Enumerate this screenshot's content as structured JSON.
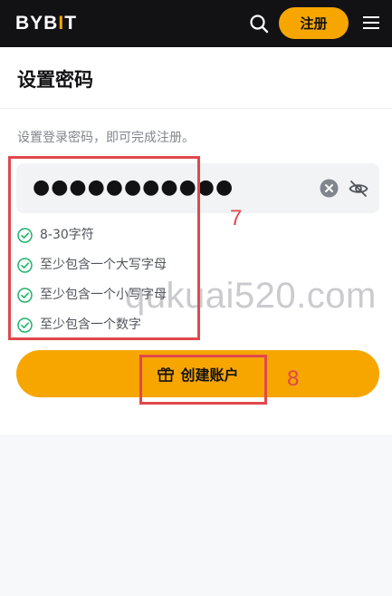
{
  "header": {
    "logo": {
      "prefix": "BYB",
      "highlight": "I",
      "suffix": "T"
    },
    "register_label": "注册",
    "icons": {
      "search": "search-icon",
      "menu": "menu-icon"
    }
  },
  "form": {
    "title": "设置密码",
    "subtitle": "设置登录密码，即可完成注册。",
    "password_value": "●●●●●●●●●●●",
    "icons": {
      "clear": "clear-circle-icon",
      "visibility": "eye-off-icon"
    },
    "rules": [
      {
        "text": "8-30字符",
        "status": "passed"
      },
      {
        "text": "至少包含一个大写字母",
        "status": "passed"
      },
      {
        "text": "至少包含一个小写字母",
        "status": "passed"
      },
      {
        "text": "至少包含一个数字",
        "status": "passed"
      }
    ],
    "submit_label": "创建账户"
  },
  "annotations": [
    {
      "label": "7"
    },
    {
      "label": "8"
    }
  ],
  "watermark": "qukuai520.com",
  "colors": {
    "brand": "#f7a600",
    "header_bg": "#121214",
    "check": "#20b26c",
    "annotation": "#e0484d"
  }
}
